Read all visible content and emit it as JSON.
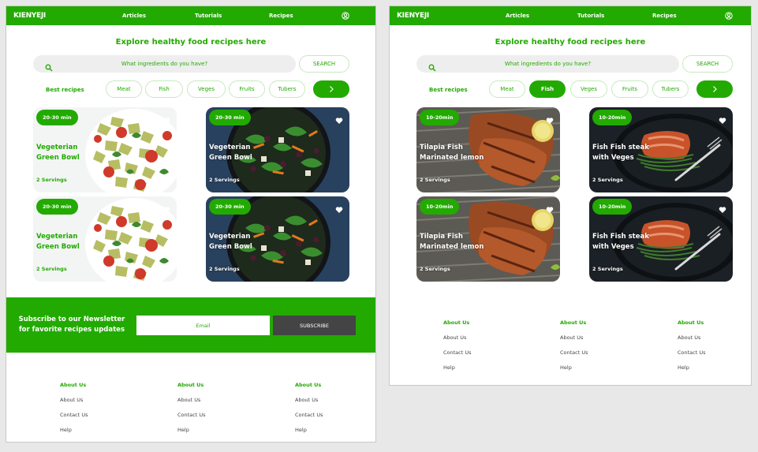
{
  "brand": {
    "logo": "KIENYEJI",
    "accent": "#22aa00",
    "dark_button": "#444444"
  },
  "nav": {
    "links": [
      "Articles",
      "Tutorials",
      "Recipes"
    ],
    "user_icon": "user-circle-icon"
  },
  "hero": {
    "headline": "Explore  healthy food recipes here"
  },
  "search": {
    "placeholder": "What ingredients do you have?",
    "button": "SEARCH",
    "icon": "search-icon"
  },
  "filters": {
    "label": "Best recipes",
    "chips": [
      "Meat",
      "Fish",
      "Veges",
      "Fruits",
      "Tubers"
    ],
    "next_icon": "chevron-right-icon"
  },
  "screens": [
    {
      "active_chip": "",
      "cards": [
        {
          "time": "20-30 min",
          "title": "Vegeterian\nGreen Bowl",
          "servings": "2 Servings",
          "image": "pasta-salad"
        },
        {
          "time": "20-30 min",
          "title": "Vegeterian\nGreen Bowl",
          "servings": "2 Servings",
          "image": "salad-bowl"
        },
        {
          "time": "20-30 min",
          "title": "Vegeterian\nGreen Bowl",
          "servings": "2 Servings",
          "image": "pasta-salad"
        },
        {
          "time": "20-30 min",
          "title": "Vegeterian\nGreen Bowl",
          "servings": "2 Servings",
          "image": "salad-bowl"
        }
      ]
    },
    {
      "active_chip": "Fish",
      "cards": [
        {
          "time": "10-20min",
          "title": "Tilapia Fish\nMarinated lemon",
          "servings": "2 Servings",
          "image": "grilled-fish"
        },
        {
          "time": "10-20min",
          "title": "Fish Fish steak\nwith Veges",
          "servings": "2 Servings",
          "image": "salmon-plate"
        },
        {
          "time": "10-20min",
          "title": "Tilapia Fish\nMarinated lemon",
          "servings": "2 Servings",
          "image": "grilled-fish"
        },
        {
          "time": "10-20min",
          "title": "Fish Fish steak\nwith Veges",
          "servings": "2 Servings",
          "image": "salmon-plate"
        }
      ]
    }
  ],
  "newsletter": {
    "text": "Subscribe to our Newsletter\nfor favorite recipes updates",
    "email_placeholder": "Email",
    "button": "SUBSCRIBE"
  },
  "footer": {
    "columns": [
      {
        "heading": "About Us",
        "links": [
          "About Us",
          "Contact Us",
          "Help"
        ]
      },
      {
        "heading": "About Us",
        "links": [
          "About Us",
          "Contact Us",
          "Help"
        ]
      },
      {
        "heading": "About Us",
        "links": [
          "About Us",
          "Contact Us",
          "Help"
        ]
      }
    ]
  }
}
